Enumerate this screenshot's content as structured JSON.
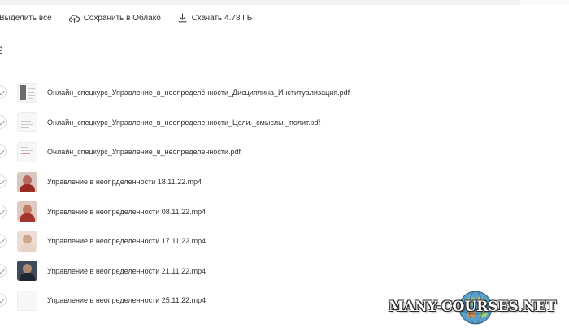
{
  "toolbar": {
    "select_all_label": "Выделить все",
    "save_cloud_label": "Сохранить в Облако",
    "download_label": "Скачать 4.78 ГБ"
  },
  "folder": {
    "count_label": "2"
  },
  "files": [
    {
      "name": "Онлайн_спецкурс_Управление_в_неопределённости_Дисциплина_Институализация.pdf",
      "thumb": "doc-dark"
    },
    {
      "name": "Онлайн_спецкурс_Управление_в_неопределенности_Цели._смыслы._полит.pdf",
      "thumb": "doc-light"
    },
    {
      "name": "Онлайн_спецкурс_Управление_в_неопределенности.pdf",
      "thumb": "doc-light"
    },
    {
      "name": "Управление в неопрделенности 18.11.22.mp4",
      "thumb": "video-red"
    },
    {
      "name": "Управление в неопределенности 08.11.22.mp4",
      "thumb": "video-red"
    },
    {
      "name": "Управление в неопределенности 17.11.22.mp4",
      "thumb": "video-light"
    },
    {
      "name": "Управление в неопределенности 21.11.22.mp4",
      "thumb": "video-dark"
    },
    {
      "name": "Управление в неопределенности 25.11.22.mp4",
      "thumb": "doc-blank"
    }
  ],
  "watermark": {
    "text": "MANY-COURSES.NET"
  },
  "colors": {
    "text": "#333333",
    "checkbox_border": "#dcdcdc",
    "top_bar": "#f2f3f5"
  },
  "icons": {
    "save_cloud": "cloud-upload-icon",
    "download": "download-icon",
    "row_check": "check-icon"
  }
}
